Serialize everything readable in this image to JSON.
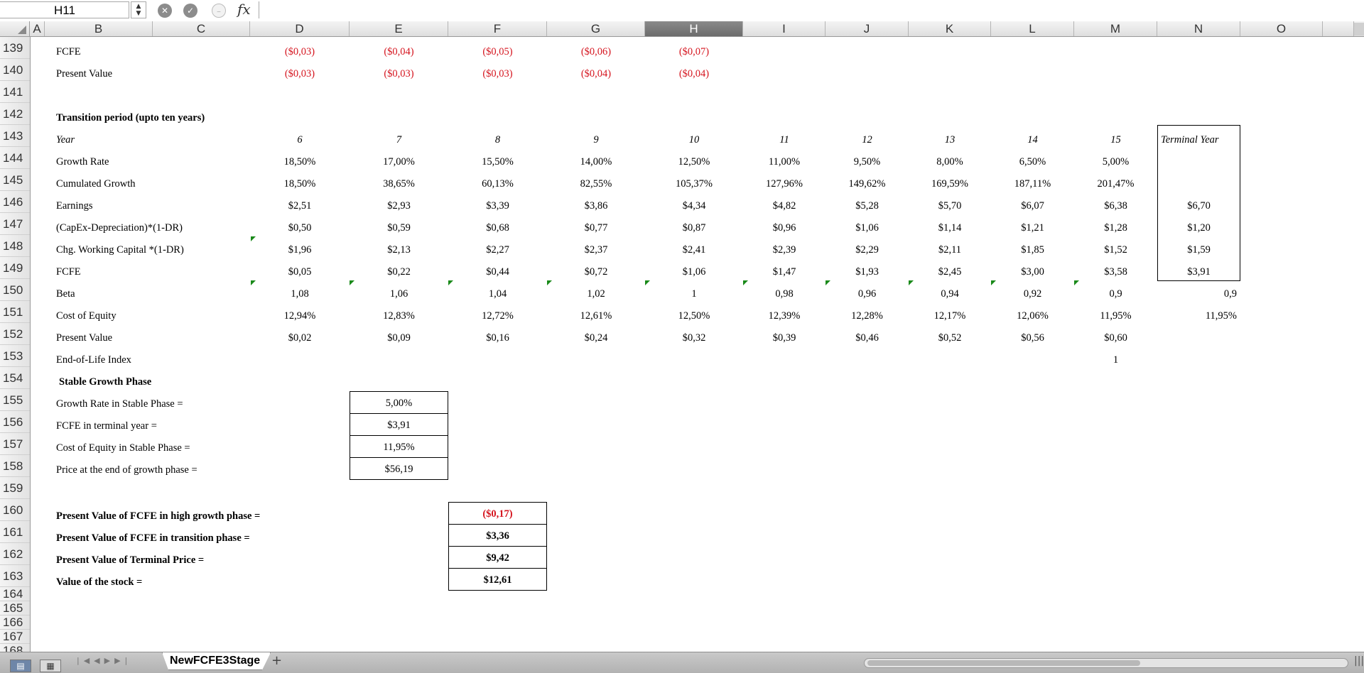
{
  "formula_bar": {
    "name_box": "H11",
    "fx_label": "fx",
    "formula": ""
  },
  "columns": [
    "A",
    "B",
    "C",
    "D",
    "E",
    "F",
    "G",
    "H",
    "I",
    "J",
    "K",
    "L",
    "M",
    "N",
    "O"
  ],
  "selected_column": "H",
  "row_numbers": [
    "139",
    "140",
    "141",
    "142",
    "143",
    "144",
    "145",
    "146",
    "147",
    "148",
    "149",
    "150",
    "151",
    "152",
    "153",
    "154",
    "155",
    "156",
    "157",
    "158",
    "159",
    "160",
    "161",
    "162",
    "163",
    "164",
    "165",
    "166",
    "167",
    "168"
  ],
  "high_growth": {
    "fcfe": {
      "label": "FCFE",
      "values": [
        "($0,03)",
        "($0,04)",
        "($0,05)",
        "($0,06)",
        "($0,07)"
      ]
    },
    "present_value": {
      "label": "Present Value",
      "values": [
        "($0,03)",
        "($0,03)",
        "($0,03)",
        "($0,04)",
        "($0,04)"
      ]
    }
  },
  "transition": {
    "title": "Transition period (upto ten years)",
    "year": {
      "label": "Year",
      "values": [
        "6",
        "7",
        "8",
        "9",
        "10",
        "11",
        "12",
        "13",
        "14",
        "15"
      ],
      "terminal": "Terminal Year"
    },
    "growth_rate": {
      "label": "Growth Rate",
      "values": [
        "18,50%",
        "17,00%",
        "15,50%",
        "14,00%",
        "12,50%",
        "11,00%",
        "9,50%",
        "8,00%",
        "6,50%",
        "5,00%"
      ]
    },
    "cumulated_growth": {
      "label": "Cumulated Growth",
      "values": [
        "18,50%",
        "38,65%",
        "60,13%",
        "82,55%",
        "105,37%",
        "127,96%",
        "149,62%",
        "169,59%",
        "187,11%",
        "201,47%"
      ]
    },
    "earnings": {
      "label": "Earnings",
      "values": [
        "$2,51",
        "$2,93",
        "$3,39",
        "$3,86",
        "$4,34",
        "$4,82",
        "$5,28",
        "$5,70",
        "$6,07",
        "$6,38"
      ],
      "terminal": "$6,70"
    },
    "capex": {
      "label": "(CapEx-Depreciation)*(1-DR)",
      "values": [
        "$0,50",
        "$0,59",
        "$0,68",
        "$0,77",
        "$0,87",
        "$0,96",
        "$1,06",
        "$1,14",
        "$1,21",
        "$1,28"
      ],
      "terminal": "$1,20"
    },
    "working_capital": {
      "label": "Chg. Working Capital *(1-DR)",
      "values": [
        "$1,96",
        "$2,13",
        "$2,27",
        "$2,37",
        "$2,41",
        "$2,39",
        "$2,29",
        "$2,11",
        "$1,85",
        "$1,52"
      ],
      "terminal": "$1,59"
    },
    "fcfe": {
      "label": "FCFE",
      "values": [
        "$0,05",
        "$0,22",
        "$0,44",
        "$0,72",
        "$1,06",
        "$1,47",
        "$1,93",
        "$2,45",
        "$3,00",
        "$3,58"
      ],
      "terminal": "$3,91"
    },
    "beta": {
      "label": "Beta",
      "values": [
        "1,08",
        "1,06",
        "1,04",
        "1,02",
        "1",
        "0,98",
        "0,96",
        "0,94",
        "0,92",
        "0,9"
      ],
      "terminal": "0,9"
    },
    "cost_of_equity": {
      "label": "Cost of Equity",
      "values": [
        "12,94%",
        "12,83%",
        "12,72%",
        "12,61%",
        "12,50%",
        "12,39%",
        "12,28%",
        "12,17%",
        "12,06%",
        "11,95%"
      ],
      "terminal": "11,95%"
    },
    "present_value": {
      "label": "Present Value",
      "values": [
        "$0,02",
        "$0,09",
        "$0,16",
        "$0,24",
        "$0,32",
        "$0,39",
        "$0,46",
        "$0,52",
        "$0,56",
        "$0,60"
      ]
    },
    "end_of_life": {
      "label": "End-of-Life Index",
      "value": "1"
    }
  },
  "stable": {
    "title": "Stable Growth Phase",
    "rows": [
      {
        "label": "Growth Rate in Stable Phase =",
        "value": "5,00%"
      },
      {
        "label": "FCFE in terminal year =",
        "value": "$3,91"
      },
      {
        "label": "Cost of Equity in Stable Phase =",
        "value": "11,95%"
      },
      {
        "label": "Price at the end of growth phase =",
        "value": "$56,19"
      }
    ]
  },
  "summary": {
    "rows": [
      {
        "label": "Present Value of FCFE in high growth phase =",
        "value": "($0,17)"
      },
      {
        "label": "Present Value of FCFE in transition phase =",
        "value": "$3,36"
      },
      {
        "label": "Present Value of Terminal Price =",
        "value": "$9,42"
      },
      {
        "label": "Value of the stock =",
        "value": "$12,61"
      }
    ]
  },
  "sheet_tabs": {
    "active": "NewFCFE3Stage",
    "add": "+"
  },
  "colors": {
    "negative": "#d5141e",
    "comment_marker": "#1a8a1a",
    "selected_header": "#7a7a7a"
  }
}
